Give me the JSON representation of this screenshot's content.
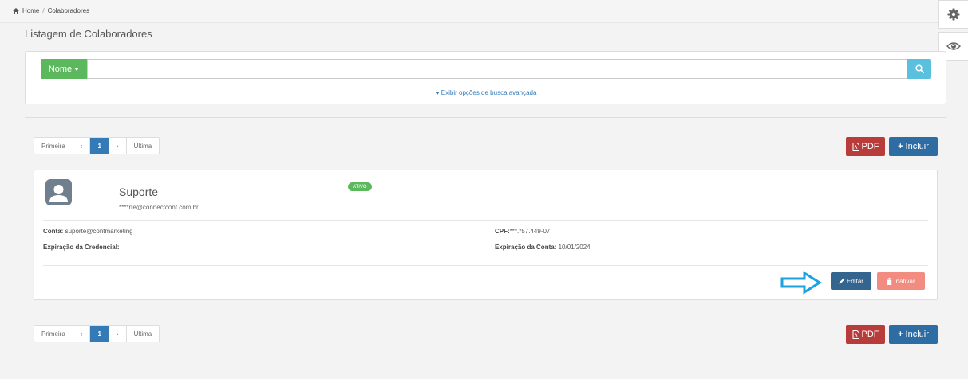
{
  "breadcrumb": {
    "home": "Home",
    "separator": "/",
    "current": "Colaboradores"
  },
  "page": {
    "title": "Listagem de Colaboradores"
  },
  "search": {
    "field_button": "Nome",
    "query": "",
    "advanced_link": "Exibir opções de busca avançada"
  },
  "pagination": {
    "first": "Primeira",
    "prev": "‹",
    "current": "1",
    "next": "›",
    "last": "Última"
  },
  "actions": {
    "pdf": "PDF",
    "incluir": "Incluir"
  },
  "collaborator": {
    "name": "Suporte",
    "email": "****rte@connectcont.com.br",
    "status": "ATIVO",
    "conta_label": "Conta:",
    "conta_value": "suporte@contmarketing",
    "cpf_label": "CPF:",
    "cpf_value": "***.*57.449-07",
    "exp_credencial_label": "Expiração da Credencial:",
    "exp_credencial_value": "",
    "exp_conta_label": "Expiração da Conta:",
    "exp_conta_value": "10/01/2024",
    "edit_label": "Editar",
    "inactivate_label": "Inativar"
  },
  "colors": {
    "success": "#5cb85c",
    "info": "#5bc0de",
    "primary": "#2e6da4",
    "danger": "#b83c3a",
    "danger_light": "#f28b80",
    "annotation_arrow": "#1aa3df"
  }
}
